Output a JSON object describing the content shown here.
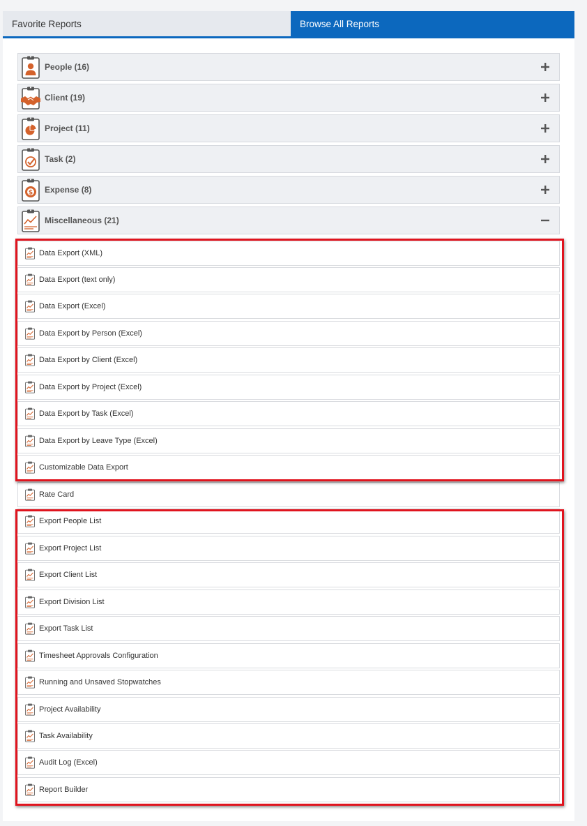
{
  "tabs": {
    "favorite": "Favorite Reports",
    "browse": "Browse All Reports"
  },
  "categories": [
    {
      "label": "People (16)",
      "icon": "person-clipboard-icon",
      "expanded": false
    },
    {
      "label": "Client (19)",
      "icon": "handshake-clipboard-icon",
      "expanded": false
    },
    {
      "label": "Project (11)",
      "icon": "pie-chart-clipboard-icon",
      "expanded": false
    },
    {
      "label": "Task (2)",
      "icon": "checkmark-clipboard-icon",
      "expanded": false
    },
    {
      "label": "Expense (8)",
      "icon": "dollar-clipboard-icon",
      "expanded": false
    },
    {
      "label": "Miscellaneous (21)",
      "icon": "line-chart-clipboard-icon",
      "expanded": true
    }
  ],
  "misc_reports": [
    "Data Export (XML)",
    "Data Export (text only)",
    "Data Export (Excel)",
    "Data Export by Person (Excel)",
    "Data Export by Client (Excel)",
    "Data Export by Project (Excel)",
    "Data Export by Task (Excel)",
    "Data Export by Leave Type (Excel)",
    "Customizable Data Export",
    "Rate Card",
    "Export People List",
    "Export Project List",
    "Export Client List",
    "Export Division List",
    "Export Task List",
    "Timesheet Approvals Configuration",
    "Running and Unsaved Stopwatches",
    "Project Availability",
    "Task Availability",
    "Audit Log (Excel)",
    "Report Builder"
  ],
  "colors": {
    "accent": "#0c68be",
    "icon": "#d4622c",
    "highlight": "#e0141e"
  }
}
